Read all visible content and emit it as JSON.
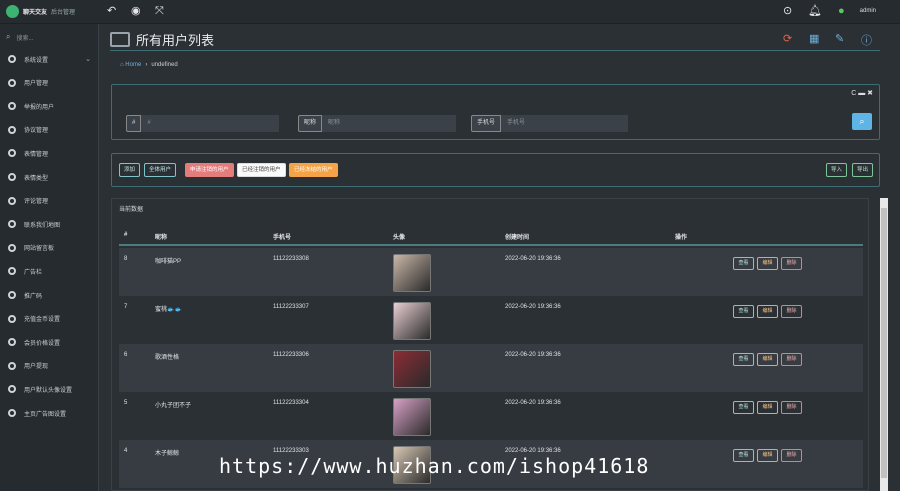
{
  "app": {
    "name": "聊天交友",
    "subtitle": "后台管理",
    "brand_color": "#3cb371"
  },
  "topbar": {
    "icons": [
      "back-icon",
      "record-icon",
      "expand-icon",
      "download-icon",
      "bell-icon",
      "user-icon"
    ],
    "user": "admin"
  },
  "sidebar": {
    "search_placeholder": "搜索...",
    "items": [
      {
        "label": "系统设置",
        "icon": "gear-icon",
        "has_children": true
      },
      {
        "label": "用户管理",
        "icon": "users-icon"
      },
      {
        "label": "举报的用户",
        "icon": "report-icon"
      },
      {
        "label": "协议管理",
        "icon": "doc-icon"
      },
      {
        "label": "表情管理",
        "icon": "emoji-icon"
      },
      {
        "label": "表情类型",
        "icon": "emoji-icon"
      },
      {
        "label": "评论管理",
        "icon": "comment-icon"
      },
      {
        "label": "联系我们地图",
        "icon": "map-pin-icon"
      },
      {
        "label": "网站留言板",
        "icon": "message-icon"
      },
      {
        "label": "广告栏",
        "icon": "ad-icon"
      },
      {
        "label": "推广码",
        "icon": "qrcode-icon"
      },
      {
        "label": "充值金币设置",
        "icon": "gear-icon"
      },
      {
        "label": "会员价格设置",
        "icon": "gear-icon"
      },
      {
        "label": "用户提现",
        "icon": "gear-icon"
      },
      {
        "label": "用户默认头像设置",
        "icon": "user-icon"
      },
      {
        "label": "主页广告图设置",
        "icon": "user-icon"
      }
    ]
  },
  "header": {
    "title": "所有用户列表",
    "icons": [
      "refresh-icon",
      "grid-icon",
      "edit-icon",
      "help-icon"
    ]
  },
  "breadcrumb": {
    "home": "Home",
    "separator": "›",
    "current": "undefined"
  },
  "filters": [
    {
      "label": "#",
      "placeholder": "#"
    },
    {
      "label": "昵称",
      "placeholder": "昵称"
    },
    {
      "label": "手机号",
      "placeholder": "手机号"
    }
  ],
  "filter_tools": "C ▬ ✖",
  "actions": {
    "add": "添加",
    "all": "全体用户",
    "apply_cancel": "申请注销的用户",
    "cancelled": "已经注销的用户",
    "frozen": "已经冻结的用户",
    "import": "导入",
    "export": "导出"
  },
  "table": {
    "caption": "当前数据",
    "headers": [
      "#",
      "昵称",
      "手机号",
      "头像",
      "创建时间",
      "操作"
    ],
    "row_actions": {
      "view": "查看",
      "edit": "编辑",
      "delete": "删除"
    },
    "rows": [
      {
        "id": "8",
        "nickname": "咖啡猫PP",
        "phone": "11122233308",
        "created": "2022-06-20 19:36:36",
        "avatar_color": "#c9b7a8"
      },
      {
        "id": "7",
        "nickname": "蜜桃🐟🐟",
        "phone": "11122233307",
        "created": "2022-06-20 19:36:36",
        "avatar_color": "#e8cfd2"
      },
      {
        "id": "6",
        "nickname": "歌酒性格",
        "phone": "11122233306",
        "created": "2022-06-20 19:36:36",
        "avatar_color": "#8b2d35"
      },
      {
        "id": "5",
        "nickname": "小丸子团不子",
        "phone": "11122233304",
        "created": "2022-06-20 19:36:36",
        "avatar_color": "#d7a0c5"
      },
      {
        "id": "4",
        "nickname": "木子鲸鲸",
        "phone": "11122233303",
        "created": "2022-06-20 19:36:36",
        "avatar_color": "#d8c8b4"
      }
    ]
  },
  "watermark": "https://www.huzhan.com/ishop41618"
}
